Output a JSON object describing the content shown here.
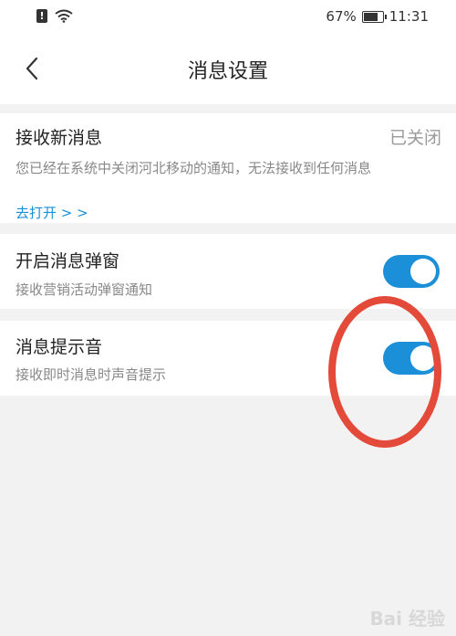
{
  "status_bar": {
    "sim_label": "!",
    "battery": "67%",
    "time": "11:31"
  },
  "header": {
    "title": "消息设置"
  },
  "settings": [
    {
      "title": "接收新消息",
      "status": "已关闭",
      "description": "您已经在系统中关闭河北移动的通知，无法接收到任何消息",
      "link": "去打开 > >"
    },
    {
      "title": "开启消息弹窗",
      "description": "接收营销活动弹窗通知",
      "enabled": true
    },
    {
      "title": "消息提示音",
      "description": "接收即时消息时声音提示",
      "enabled": true
    }
  ],
  "colors": {
    "toggle_on": "#1b8fd7",
    "link": "#1a8fd6",
    "annotation": "#e34a3a"
  },
  "watermark": "Bai 经验"
}
